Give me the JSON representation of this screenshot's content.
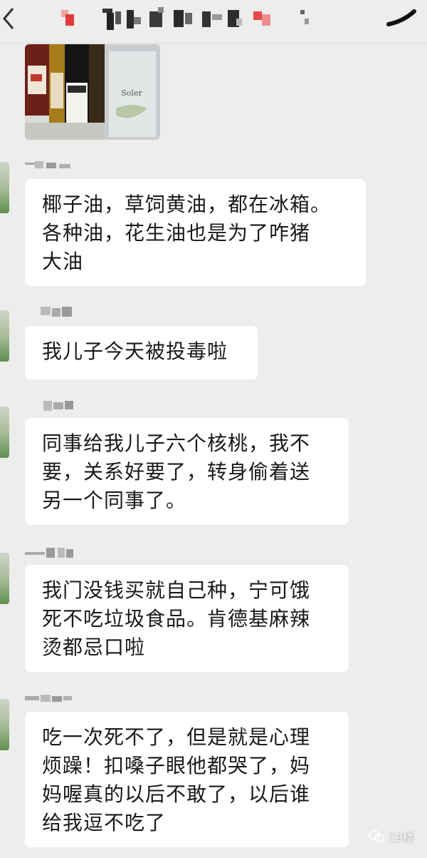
{
  "messages": [
    {
      "text": "椰子油，草饲黄油，都在冰箱。\n各种油，花生油也是为了咋猪\n大油"
    },
    {
      "text": "我儿子今天被投毒啦"
    },
    {
      "text": "同事给我儿子六个核桃，我不\n要，关系好要了，转身偷着送\n另一个同事了。"
    },
    {
      "text": "我门没钱买就自己种，宁可饿\n死不吃垃圾食品。肯德基麻辣\n烫都忌口啦"
    },
    {
      "text": "吃一次死不了，但是就是心理\n烦躁！扣嗓子眼他都哭了，妈\n妈喔真的以后不敢了，以后谁\n给我逗不吃了"
    }
  ],
  "photo": {
    "label": "Soler"
  },
  "watermark": {
    "text": "19楼"
  },
  "icons": {
    "back": "back-arrow-icon",
    "more": "more-icon",
    "watermark_logo": "wechat-logo-icon"
  }
}
